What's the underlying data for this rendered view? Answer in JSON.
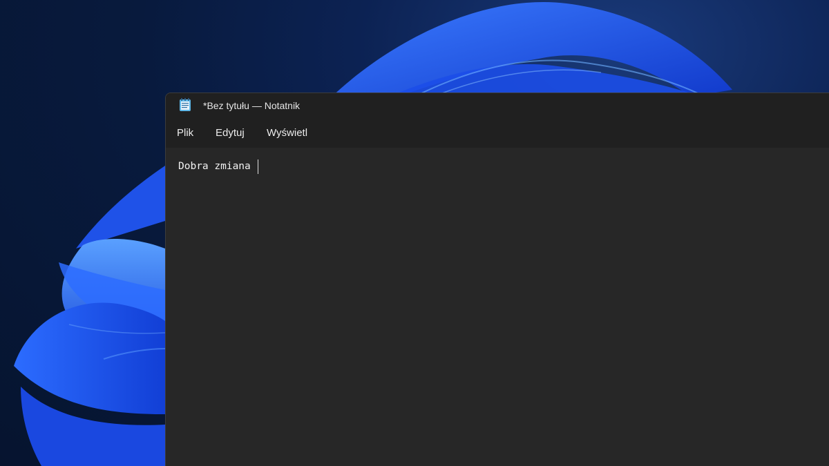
{
  "window": {
    "title": "*Bez tytułu — Notatnik",
    "app_icon": "notepad-icon"
  },
  "menu": {
    "file_label": "Plik",
    "edit_label": "Edytuj",
    "view_label": "Wyświetl"
  },
  "editor": {
    "content": "Dobra zmiana "
  },
  "colors": {
    "window_bg": "#272727",
    "titlebar_bg": "#202020",
    "wallpaper_accent": "#1f5ef5"
  }
}
